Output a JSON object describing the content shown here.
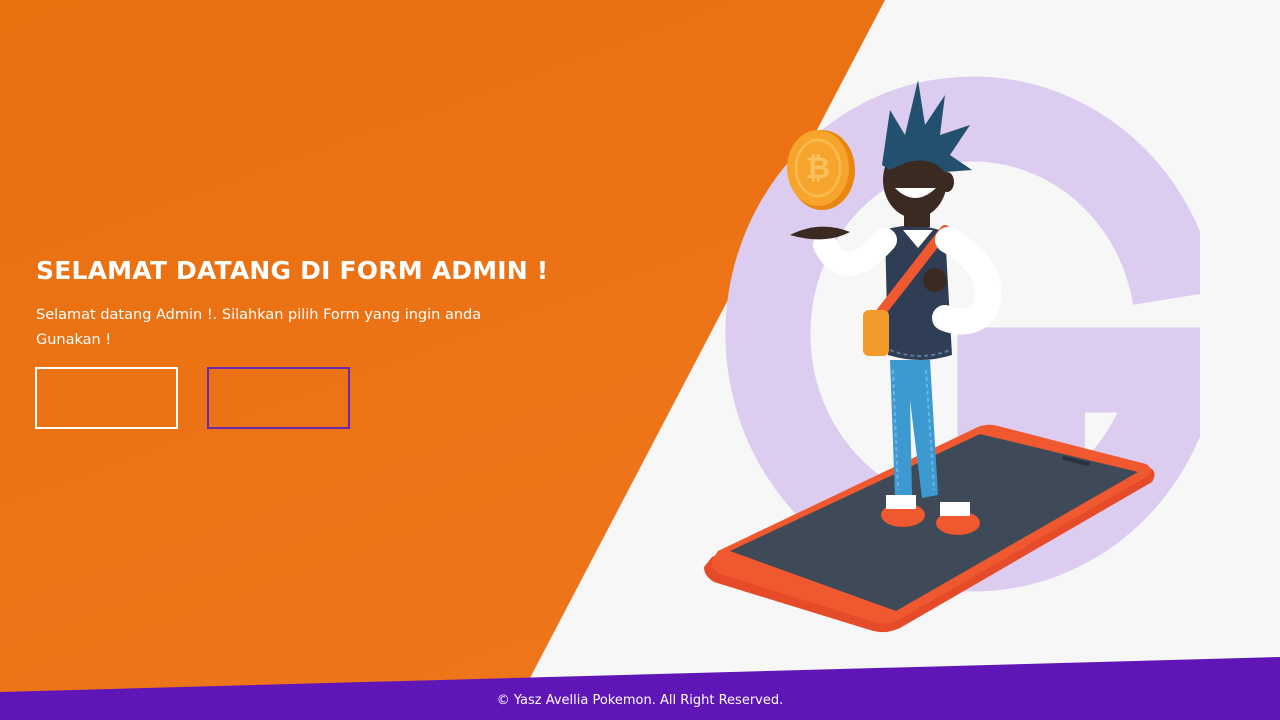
{
  "hero": {
    "title": "SELAMAT DATANG DI FORM ADMIN !",
    "subtitle": "Selamat datang Admin !. Silahkan pilih Form yang ingin anda Gunakan !"
  },
  "buttons": [
    {
      "label": ""
    },
    {
      "label": ""
    }
  ],
  "footer": {
    "text": "© Yasz Avellia Pokemon. All Right Reserved."
  },
  "illustration": {
    "icons": [
      "letter-g-icon",
      "coin-icon",
      "character-illustration",
      "smartphone-illustration"
    ]
  },
  "colors": {
    "orange": "#ee7419",
    "purple": "#6015b7",
    "background": "#f7f7f7",
    "lavender": "#dccdf0"
  }
}
